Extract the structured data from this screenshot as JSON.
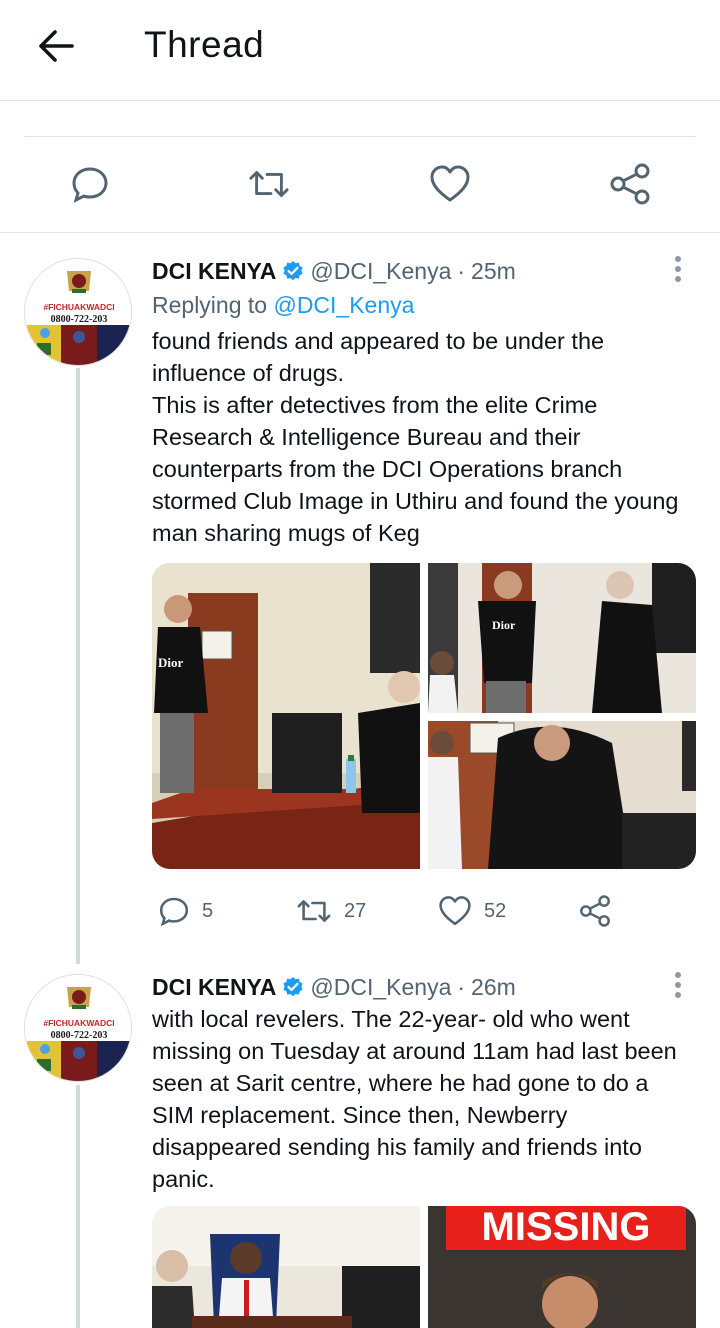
{
  "header": {
    "title": "Thread",
    "back_icon": "arrow-left-icon"
  },
  "top_actions": {
    "icons": [
      "reply-icon",
      "retweet-icon",
      "like-icon",
      "share-icon"
    ]
  },
  "tweets": [
    {
      "name": "DCI KENYA",
      "handle": "@DCI_Kenya",
      "dot": "·",
      "time": "25m",
      "reply_label": "Replying to",
      "reply_to": "@DCI_Kenya",
      "text": "found friends and appeared to be under the\ninfluence of drugs.\nThis is after detectives from the elite Crime\nResearch & Intelligence Bureau and their\ncounterparts from the DCI Operations branch\nstormed Club Image in Uthiru and found the young\nman sharing mugs of Keg",
      "avatar": {
        "tag": "#FICHUAKWADCI",
        "phone": "0800-722-203"
      },
      "media": {
        "sign_text": "Dior",
        "shirt_text": "Dior"
      },
      "counts": {
        "replies": "5",
        "retweets": "27",
        "likes": "52"
      }
    },
    {
      "name": "DCI KENYA",
      "handle": "@DCI_Kenya",
      "dot": "·",
      "time": "26m",
      "text": "with local revelers. The 22-year- old who went\nmissing on Tuesday at around 11am had last been\nseen at Sarit centre, where he had gone to do a\nSIM replacement. Since then, Newberry\ndisappeared sending his family and friends into\npanic.",
      "avatar": {
        "tag": "#FICHUAKWADCI",
        "phone": "0800-722-203"
      },
      "media": {
        "banner_text": "MISSING"
      }
    }
  ],
  "colors": {
    "accent": "#1d9bf0",
    "muted": "#536471",
    "text": "#0f1419",
    "divider": "#e1e6ea",
    "thread_line": "#cfd9de",
    "missing_red": "#e8201c"
  }
}
